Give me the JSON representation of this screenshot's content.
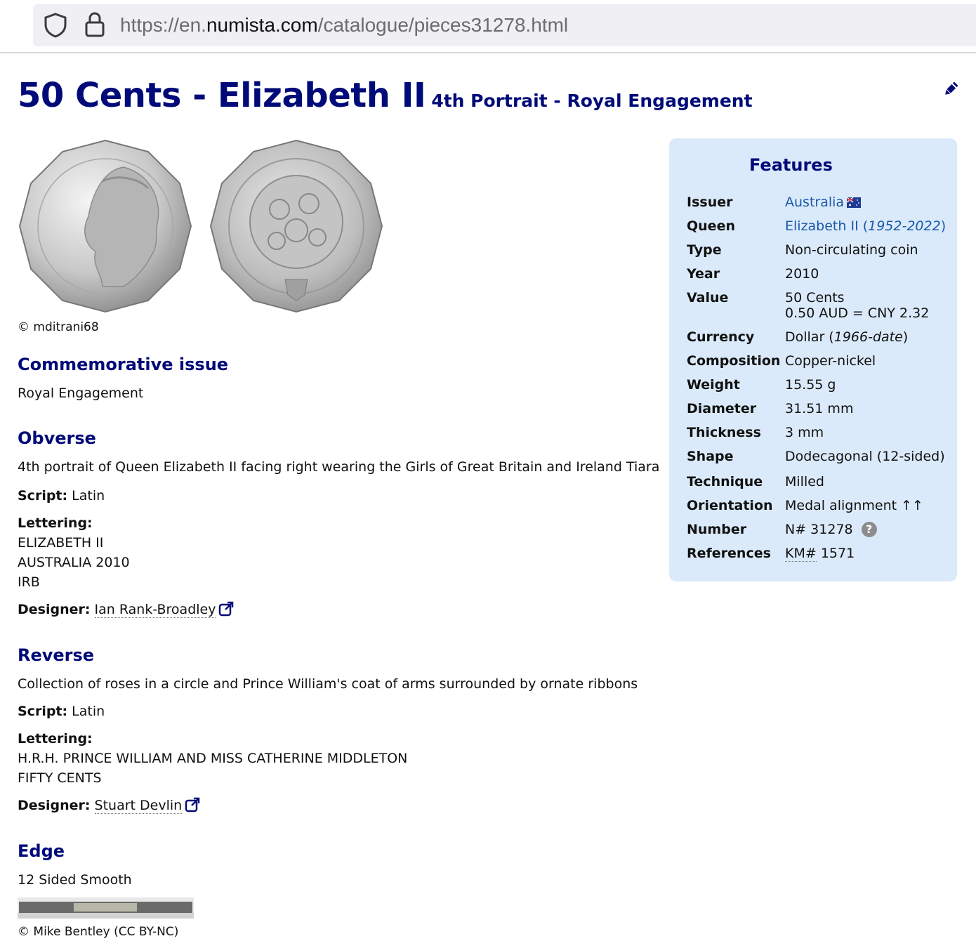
{
  "browser": {
    "url_prefix": "https://en.",
    "url_domain": "numista.com",
    "url_path": "/catalogue/pieces31278.html"
  },
  "page": {
    "title_main": "50 Cents - Elizabeth II",
    "title_sub": "4th Portrait - Royal Engagement",
    "photo_credit": "© mditrani68"
  },
  "commemorative": {
    "heading": "Commemorative issue",
    "text": "Royal Engagement"
  },
  "obverse": {
    "heading": "Obverse",
    "description": "4th portrait of Queen Elizabeth II facing right wearing the Girls of Great Britain and Ireland Tiara",
    "script_label": "Script:",
    "script_value": "Latin",
    "lettering_label": "Lettering:",
    "lettering": [
      "ELIZABETH II",
      "AUSTRALIA 2010",
      "IRB"
    ],
    "designer_label": "Designer:",
    "designer": "Ian Rank-Broadley"
  },
  "reverse": {
    "heading": "Reverse",
    "description": "Collection of roses in a circle and Prince William's coat of arms surrounded by ornate ribbons",
    "script_label": "Script:",
    "script_value": "Latin",
    "lettering_label": "Lettering:",
    "lettering": [
      "H.R.H. PRINCE WILLIAM AND MISS CATHERINE MIDDLETON",
      "FIFTY CENTS"
    ],
    "designer_label": "Designer:",
    "designer": "Stuart Devlin"
  },
  "edge": {
    "heading": "Edge",
    "text": "12 Sided Smooth",
    "credit": "© Mike Bentley (CC BY-NC)"
  },
  "features": {
    "heading": "Features",
    "issuer_label": "Issuer",
    "issuer": "Australia",
    "queen_label": "Queen",
    "queen_name": "Elizabeth II (",
    "queen_years": "1952-2022",
    "queen_close": ")",
    "type_label": "Type",
    "type": "Non-circulating coin",
    "year_label": "Year",
    "year": "2010",
    "value_label": "Value",
    "value_line1": "50 Cents",
    "value_line2": "0.50 AUD = CNY 2.32",
    "currency_label": "Currency",
    "currency_name": "Dollar (",
    "currency_years": "1966-date",
    "currency_close": ")",
    "composition_label": "Composition",
    "composition": "Copper-nickel",
    "weight_label": "Weight",
    "weight": "15.55 g",
    "diameter_label": "Diameter",
    "diameter": "31.51 mm",
    "thickness_label": "Thickness",
    "thickness": "3 mm",
    "shape_label": "Shape",
    "shape": "Dodecagonal (12-sided)",
    "technique_label": "Technique",
    "technique": "Milled",
    "orientation_label": "Orientation",
    "orientation": "Medal alignment ↑↑",
    "number_label": "Number",
    "number": "N# 31278",
    "references_label": "References",
    "ref_prefix": "KM#",
    "ref_number": "1571"
  },
  "icons": {
    "shield": "shield-icon",
    "lock": "lock-icon",
    "edit": "edit-pencil-icon",
    "external": "external-link-icon",
    "flag": "australia-flag-icon",
    "help": "help-icon"
  }
}
